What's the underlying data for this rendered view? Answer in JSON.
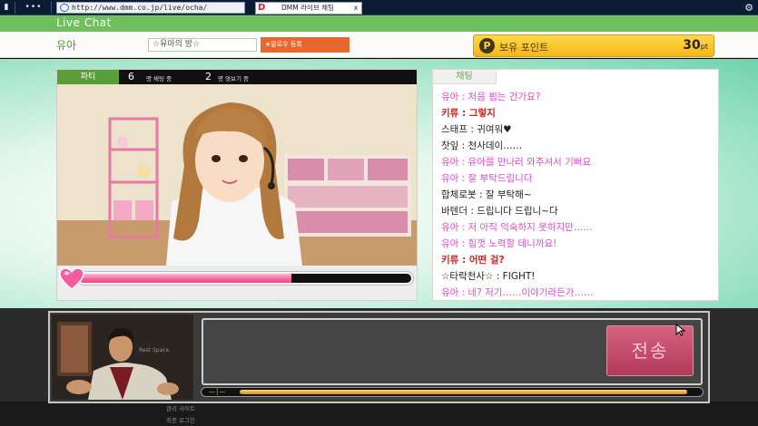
{
  "browser": {
    "url": "http://www.dmm.co.jp/live/ocha/",
    "tab_title": "DMM 라이브 채팅",
    "tab_close": "x",
    "favicon": "D"
  },
  "header": {
    "title": "Live Chat"
  },
  "room": {
    "host": "유아",
    "name": "☆유아의 방☆",
    "follow_label": "★팔로우 등록"
  },
  "points": {
    "icon": "P",
    "label": "보유 포인트",
    "value": "30",
    "unit": "pt"
  },
  "video": {
    "party_label": "파티",
    "chatting_count": "6",
    "chatting_label": "명 채팅 중",
    "watching_count": "2",
    "watching_label": "명 엿보기 중",
    "affection_level": 0.64
  },
  "chat": {
    "tab_label": "채팅",
    "messages": [
      {
        "text": "유아 : 처음 뵙는 건가요?",
        "color": "pink"
      },
      {
        "text": "키류 : 그렇지",
        "color": "red"
      },
      {
        "text": "스태프 : 귀여워♥",
        "color": "black"
      },
      {
        "text": "찻잎 : 천사데이……",
        "color": "black"
      },
      {
        "text": "유아 : 유아를 만나러 와주셔서 기뻐요",
        "color": "pink"
      },
      {
        "text": "유아 : 잘 부탁드립니다",
        "color": "pink"
      },
      {
        "text": "합체로봇 : 잘 부탁해~",
        "color": "black"
      },
      {
        "text": "바텐더 : 드립니다 드립니~다",
        "color": "black"
      },
      {
        "text": "유아 : 저 아직 익숙하지 못하지만……",
        "color": "pink"
      },
      {
        "text": "유아 : 힘껏 노력할 테니까요!",
        "color": "pink"
      },
      {
        "text": "키류 : 어떤 걸?",
        "color": "red"
      },
      {
        "text": "☆타락천사☆ : FIGHT!",
        "color": "black"
      },
      {
        "text": "유아 : 네? 저기……이야기라든가……",
        "color": "pink"
      }
    ]
  },
  "dialog": {
    "portrait_sign": "Rest Space",
    "send_label": "전송",
    "time_remaining": 0.97
  },
  "behind": {
    "line1": "관리 사이트",
    "line2": "최종 로그인"
  },
  "colors": {
    "green": "#6fbf5d",
    "pink": "#e24ad2",
    "red": "#d8201e",
    "points": "#f7b51a"
  }
}
